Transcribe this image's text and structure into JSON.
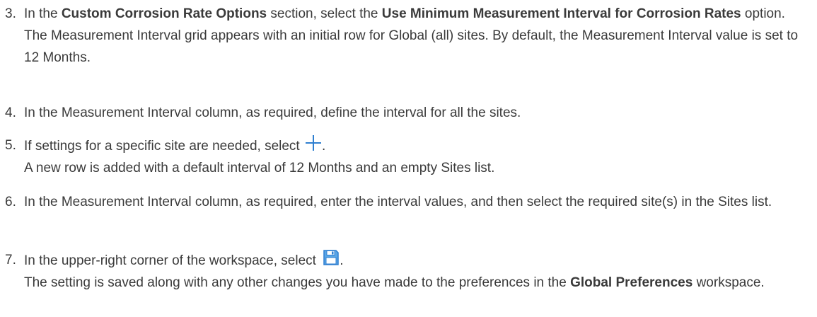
{
  "steps": [
    {
      "number": "3.",
      "text_1": "In the ",
      "bold_1": "Custom Corrosion Rate Options",
      "text_2": " section, select the ",
      "bold_2": "Use Minimum Measurement Interval for Corrosion Rates",
      "text_3": " option.",
      "result": "The Measurement Interval grid appears with an initial row for Global (all) sites. By default, the Measurement Interval value is set to 12 Months."
    },
    {
      "number": "4.",
      "text": "In the Measurement Interval column, as required, define the interval for all the sites."
    },
    {
      "number": "5.",
      "text": "If settings for a specific site are needed, select ",
      "icon": "plus-icon",
      "after_icon": ".",
      "result": "A new row is added with a default interval of 12 Months and an empty Sites list."
    },
    {
      "number": "6.",
      "text": "In the Measurement Interval column, as required, enter the interval values, and then select the required site(s) in the Sites list."
    },
    {
      "number": "7.",
      "text": "In the upper-right corner of the workspace, select ",
      "icon": "save-icon",
      "after_icon": ".",
      "result_1": "The setting is saved along with any other changes you have made to the preferences in the ",
      "result_bold": "Global Preferences",
      "result_2": " workspace."
    }
  ],
  "colors": {
    "text": "#3a3a3a",
    "icon_blue": "#2f7fd0",
    "save_icon_fill": "#5aa6e6"
  }
}
